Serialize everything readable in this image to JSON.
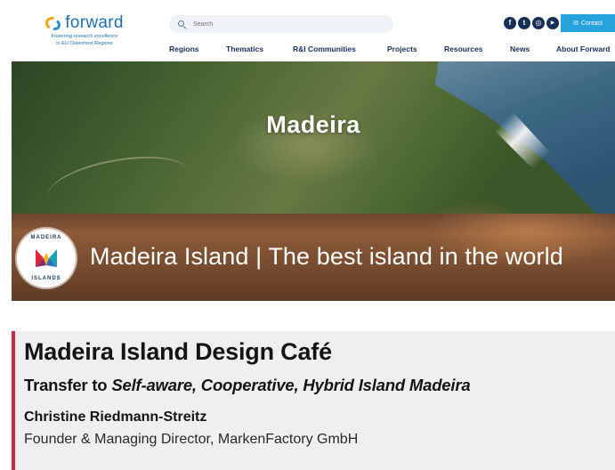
{
  "header": {
    "logo_word": "forward",
    "logo_tagline_1": "Fostering research excellence",
    "logo_tagline_2": "in EU Outermost Regions",
    "search_placeholder": "Search",
    "contact_label": "Contact",
    "socials": [
      {
        "icon": "facebook-icon",
        "glyph": "f"
      },
      {
        "icon": "twitter-icon",
        "glyph": "t"
      },
      {
        "icon": "instagram-icon",
        "glyph": "◎"
      },
      {
        "icon": "youtube-icon",
        "glyph": "▶"
      }
    ],
    "nav": [
      "Regions",
      "Thematics",
      "R&I Communities",
      "Projects",
      "Resources",
      "News",
      "About Forward"
    ]
  },
  "hero": {
    "title": "Madeira"
  },
  "banner": {
    "badge_top": "MADEIRA",
    "badge_bottom": "ISLANDS",
    "title": "Madeira Island | The best island in the world"
  },
  "talk": {
    "title": "Madeira Island Design Café",
    "subtitle_prefix": "Transfer to ",
    "subtitle_emphasis": "Self-aware, Cooperative, Hybrid Island Madeira",
    "speaker": "Christine Riedmann-Streitz",
    "role": "Founder & Managing Director, MarkenFactory GmbH"
  },
  "colors": {
    "brand_blue": "#1e6fb0",
    "nav_navy": "#16305a",
    "contact_blue": "#27a3dc",
    "accent_red": "#c62b3d",
    "card_bg": "#efefef"
  }
}
